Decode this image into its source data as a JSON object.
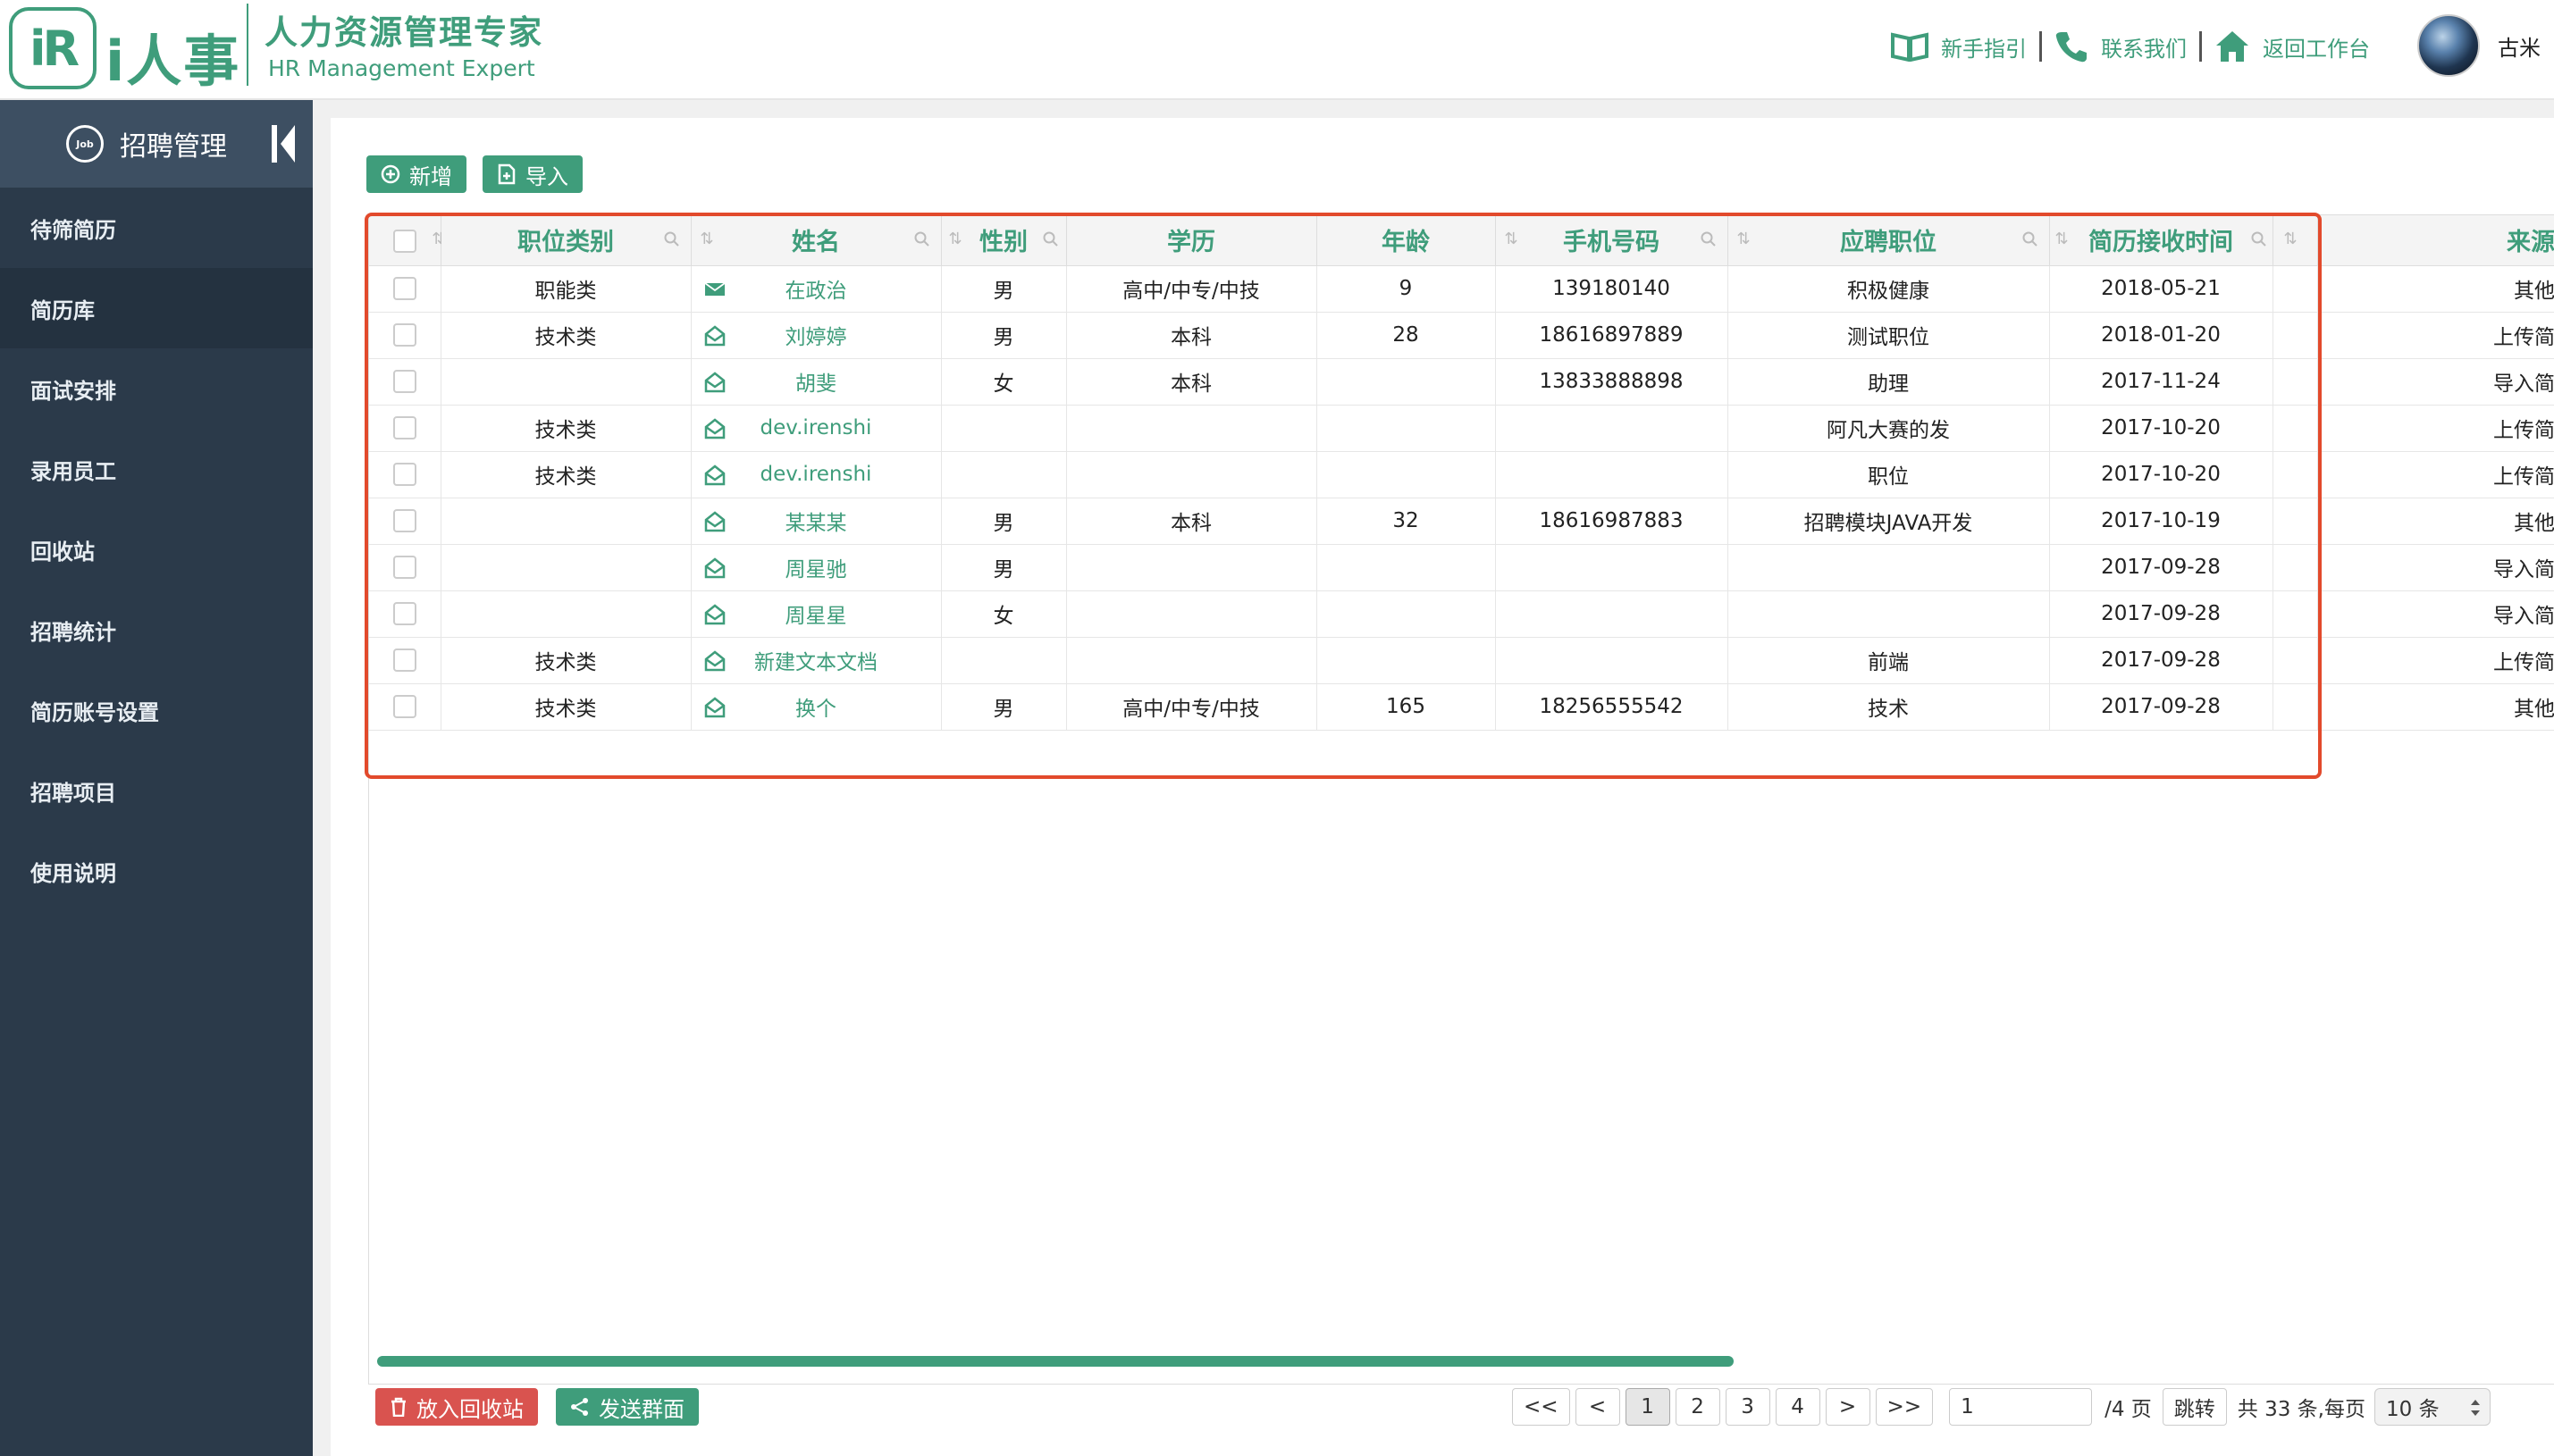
{
  "brand": {
    "logo_mark": "iR",
    "logo_text": "i人事",
    "title_cn": "人力资源管理专家",
    "title_en": "HR Management Expert"
  },
  "top_nav": {
    "guide": "新手指引",
    "contact": "联系我们",
    "workbench": "返回工作台",
    "user": "古米"
  },
  "sidebar": {
    "header": "招聘管理",
    "header_icon_text": "Job",
    "items": [
      {
        "label": "待筛简历",
        "active": false
      },
      {
        "label": "简历库",
        "active": true
      },
      {
        "label": "面试安排",
        "active": false
      },
      {
        "label": "录用员工",
        "active": false
      },
      {
        "label": "回收站",
        "active": false
      },
      {
        "label": "招聘统计",
        "active": false
      },
      {
        "label": "简历账号设置",
        "active": false
      },
      {
        "label": "招聘项目",
        "active": false
      },
      {
        "label": "使用说明",
        "active": false
      }
    ]
  },
  "toolbar": {
    "add_label": "新增",
    "import_label": "导入"
  },
  "table": {
    "columns": [
      "职位类别",
      "姓名",
      "性别",
      "学历",
      "年龄",
      "手机号码",
      "应聘职位",
      "简历接收时间",
      "来源"
    ],
    "rows": [
      {
        "category": "职能类",
        "name": "在政治",
        "icon": "mail-closed",
        "gender": "男",
        "education": "高中/中专/中技",
        "age": "9",
        "phone": "139180140",
        "position": "积极健康",
        "received": "2018-05-21",
        "source": "其他"
      },
      {
        "category": "技术类",
        "name": "刘婷婷",
        "icon": "mail-open",
        "gender": "男",
        "education": "本科",
        "age": "28",
        "phone": "18616897889",
        "position": "测试职位",
        "received": "2018-01-20",
        "source": "上传简"
      },
      {
        "category": "",
        "name": "胡斐",
        "icon": "mail-open",
        "gender": "女",
        "education": "本科",
        "age": "",
        "phone": "13833888898",
        "position": "助理",
        "received": "2017-11-24",
        "source": "导入简"
      },
      {
        "category": "技术类",
        "name": "dev.irenshi",
        "icon": "mail-open",
        "gender": "",
        "education": "",
        "age": "",
        "phone": "",
        "position": "阿凡大赛的发",
        "received": "2017-10-20",
        "source": "上传简"
      },
      {
        "category": "技术类",
        "name": "dev.irenshi",
        "icon": "mail-open",
        "gender": "",
        "education": "",
        "age": "",
        "phone": "",
        "position": "职位",
        "received": "2017-10-20",
        "source": "上传简"
      },
      {
        "category": "",
        "name": "某某某",
        "icon": "mail-open",
        "gender": "男",
        "education": "本科",
        "age": "32",
        "phone": "18616987883",
        "position": "招聘模块JAVA开发",
        "received": "2017-10-19",
        "source": "其他"
      },
      {
        "category": "",
        "name": "周星驰",
        "icon": "mail-open",
        "gender": "男",
        "education": "",
        "age": "",
        "phone": "",
        "position": "",
        "received": "2017-09-28",
        "source": "导入简"
      },
      {
        "category": "",
        "name": "周星星",
        "icon": "mail-open",
        "gender": "女",
        "education": "",
        "age": "",
        "phone": "",
        "position": "",
        "received": "2017-09-28",
        "source": "导入简"
      },
      {
        "category": "技术类",
        "name": "新建文本文档",
        "icon": "mail-open",
        "gender": "",
        "education": "",
        "age": "",
        "phone": "",
        "position": "前端",
        "received": "2017-09-28",
        "source": "上传简"
      },
      {
        "category": "技术类",
        "name": "换个",
        "icon": "mail-open",
        "gender": "男",
        "education": "高中/中专/中技",
        "age": "165",
        "phone": "18256555542",
        "position": "技术",
        "received": "2017-09-28",
        "source": "其他"
      }
    ]
  },
  "footer": {
    "recycle_label": "放入回收站",
    "group_send_label": "发送群面"
  },
  "pagination": {
    "first": "<<",
    "prev": "<",
    "pages": [
      "1",
      "2",
      "3",
      "4"
    ],
    "current": "1",
    "next": ">",
    "last": ">>",
    "jump_value": "1",
    "total_pages_text": "/4 页",
    "jump_label": "跳转",
    "summary": "共 33 条,每页",
    "page_size": "10 条"
  },
  "colors": {
    "brand_green": "#3f9d7b",
    "sidebar_bg": "#2b3a4a",
    "danger_red": "#d9534f",
    "highlight_box": "#e24a2c"
  }
}
